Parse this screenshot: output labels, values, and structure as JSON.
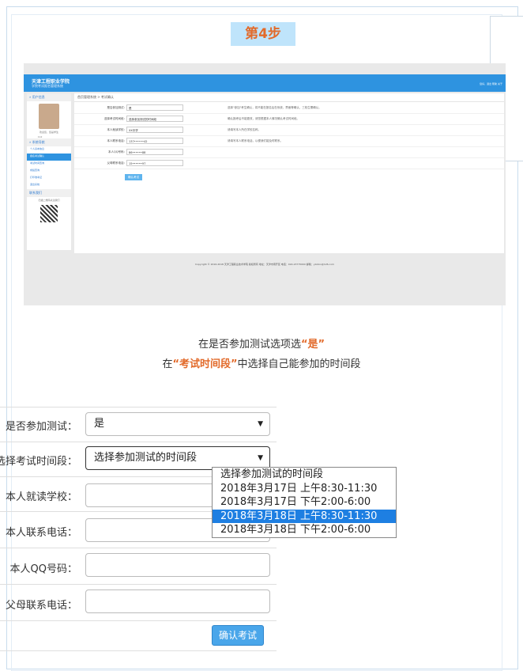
{
  "step_label": "第4步",
  "screenshot": {
    "logo_line1": "天津工程职业学院",
    "logo_line2": "学院考试报名管理系统",
    "header_right": "您好，退出 帮助 关于",
    "breadcrumb": "首页管理系统 > 考试确认",
    "sidebar": {
      "user_head": "» 用户信息",
      "welcome": "欢迎您，您是学生",
      "user_code": "112                        ",
      "nav_head": "» 系统导航",
      "nav_items": [
        "个人基本信息",
        "报名考试确认",
        "考试时间查询",
        "成绩查询",
        "打印准考证",
        "退出系统"
      ],
      "contact_head": "联系我们",
      "contact_note": "扫描二维码关注我们"
    },
    "rows": [
      {
        "label": "是否参加测试：",
        "value": "是",
        "hint": "选择\"参加\"考生确认，将不能在报名后在系统，界面等确认，三校生需确认。"
      },
      {
        "label": "选择考试时间段：",
        "value": "选择参加测试的时间段",
        "hint": "确认报考后不能更改，请您根据本人情况确认考试时间段。"
      },
      {
        "label": "本人就读学校：",
        "value": "XX中学",
        "hint": "请填写本人所在学校名称。"
      },
      {
        "label": "本人联系电话：",
        "value": "137••••••42",
        "hint": "请填写本人联系电话，以便我们能及时联系。"
      },
      {
        "label": "本人QQ号码：",
        "value": "86••••••88",
        "hint": ""
      },
      {
        "label": "父母联系电话：",
        "value": "15••••••97",
        "hint": ""
      }
    ],
    "confirm": "确认考试",
    "footer": "Copyright © 2016-2018 天津工程职业技术学院 版权所有 地址：天津市南开区 电话：022-23775000 邮箱：yzzzxx@126.com"
  },
  "caption": {
    "line1_pre": "在是否参加测试选项选",
    "line1_em": "“是”",
    "line2_pre": "在",
    "line2_em": "“考试时间段”",
    "line2_post": "中选择自己能参加的时间段"
  },
  "form": {
    "fields": [
      {
        "label": "是否参加测试：",
        "value": "是"
      },
      {
        "label": "选择考试时间段：",
        "value": "选择参加测试的时间段"
      },
      {
        "label": "本人就读学校：",
        "value": ""
      },
      {
        "label": "本人联系电话：",
        "value": ""
      },
      {
        "label": "本人QQ号码：",
        "value": ""
      },
      {
        "label": "父母联系电话：",
        "value": ""
      }
    ],
    "time_options": [
      "选择参加测试的时间段",
      "2018年3月17日 上午8:30-11:30",
      "2018年3月17日 下午2:00-6:00",
      "2018年3月18日 上午8:30-11:30",
      "2018年3月18日 下午2:00-6:00"
    ],
    "highlighted_option_index": 3,
    "confirm_label": "确认考试"
  },
  "colors": {
    "accent": "#e26a2a",
    "header_blue": "#2e93e0",
    "highlight": "#1e7fe2",
    "step_bg": "#bfe4fb"
  }
}
